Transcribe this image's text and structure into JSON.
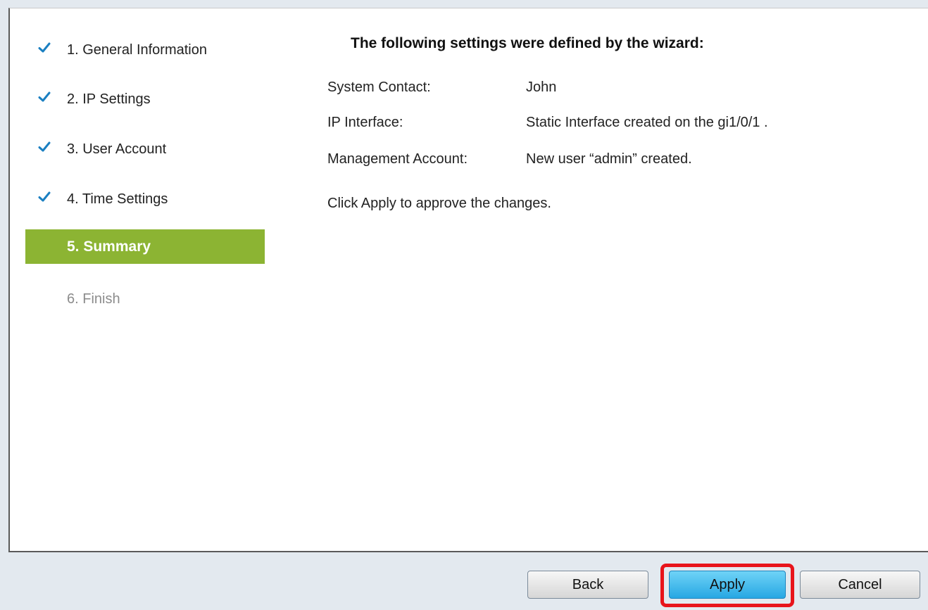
{
  "wizard": {
    "steps": [
      {
        "label": "1. General Information",
        "state": "done"
      },
      {
        "label": "2. IP Settings",
        "state": "done"
      },
      {
        "label": "3. User Account",
        "state": "done"
      },
      {
        "label": "4. Time Settings",
        "state": "done"
      },
      {
        "label": "5. Summary",
        "state": "active"
      },
      {
        "label": "6. Finish",
        "state": "pending"
      }
    ],
    "check_icon": "checkmark-icon",
    "active_color": "#8cb433",
    "check_color": "#1a7fc1"
  },
  "summary": {
    "heading": "The following settings were defined by the wizard:",
    "rows": [
      {
        "label": "System Contact:",
        "value": "John"
      },
      {
        "label": "IP Interface:",
        "value": "Static Interface created on the gi1/0/1 ."
      },
      {
        "label": "Management Account:",
        "value": "New user “admin” created."
      }
    ],
    "note": "Click Apply to approve the changes."
  },
  "footer": {
    "back_label": "Back",
    "apply_label": "Apply",
    "cancel_label": "Cancel",
    "highlight_color": "#e8141b"
  }
}
